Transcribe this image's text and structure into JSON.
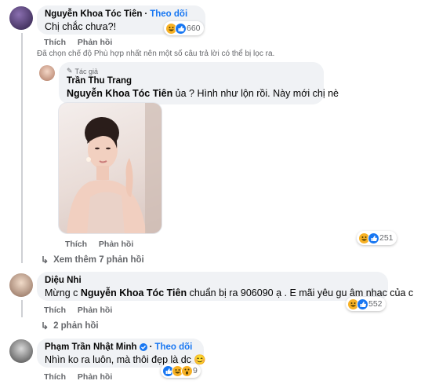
{
  "comments": [
    {
      "author": "Nguyễn Khoa Tóc Tiên",
      "follow": "Theo dõi",
      "text": "Chị chắc chưa?!",
      "reactions": {
        "icons": [
          "haha-icon",
          "like-icon"
        ],
        "count": "660"
      },
      "actions": {
        "like": "Thích",
        "reply": "Phản hồi"
      }
    },
    {
      "filter_note": "Đã chọn chế độ Phù hợp nhất nên một số câu trả lời có thể bị lọc ra."
    },
    {
      "author_tag": "Tác giả",
      "author": "Trần Thu Trang",
      "mention": "Nguyễn Khoa Tóc Tiên",
      "text": " ủa ? Hình như lộn rồi. Này mới chị nè",
      "reactions": {
        "icons": [
          "haha-icon",
          "like-icon"
        ],
        "count": "251"
      },
      "actions": {
        "like": "Thích",
        "reply": "Phản hồi"
      }
    },
    {
      "more_replies": "Xem thêm 7 phản hồi"
    },
    {
      "author": "Diệu Nhi",
      "text_prefix": "Mừng c ",
      "mention": "Nguyễn Khoa Tóc Tiên",
      "text": " chuẩn bị ra 906090 ạ . E mãi yêu gu âm nhạc của c",
      "reactions": {
        "icons": [
          "haha-icon",
          "like-icon"
        ],
        "count": "552"
      },
      "actions": {
        "like": "Thích",
        "reply": "Phản hồi"
      },
      "replies": "2 phản hồi"
    },
    {
      "author": "Phạm Trần Nhật Minh",
      "follow": "Theo dõi",
      "text": "Nhìn ko ra luôn, mà thôi đẹp là dc 😊",
      "reactions": {
        "icons": [
          "like-icon",
          "haha-icon",
          "wow-icon"
        ],
        "count": "9"
      },
      "actions": {
        "like": "Thích",
        "reply": "Phản hồi"
      }
    }
  ]
}
